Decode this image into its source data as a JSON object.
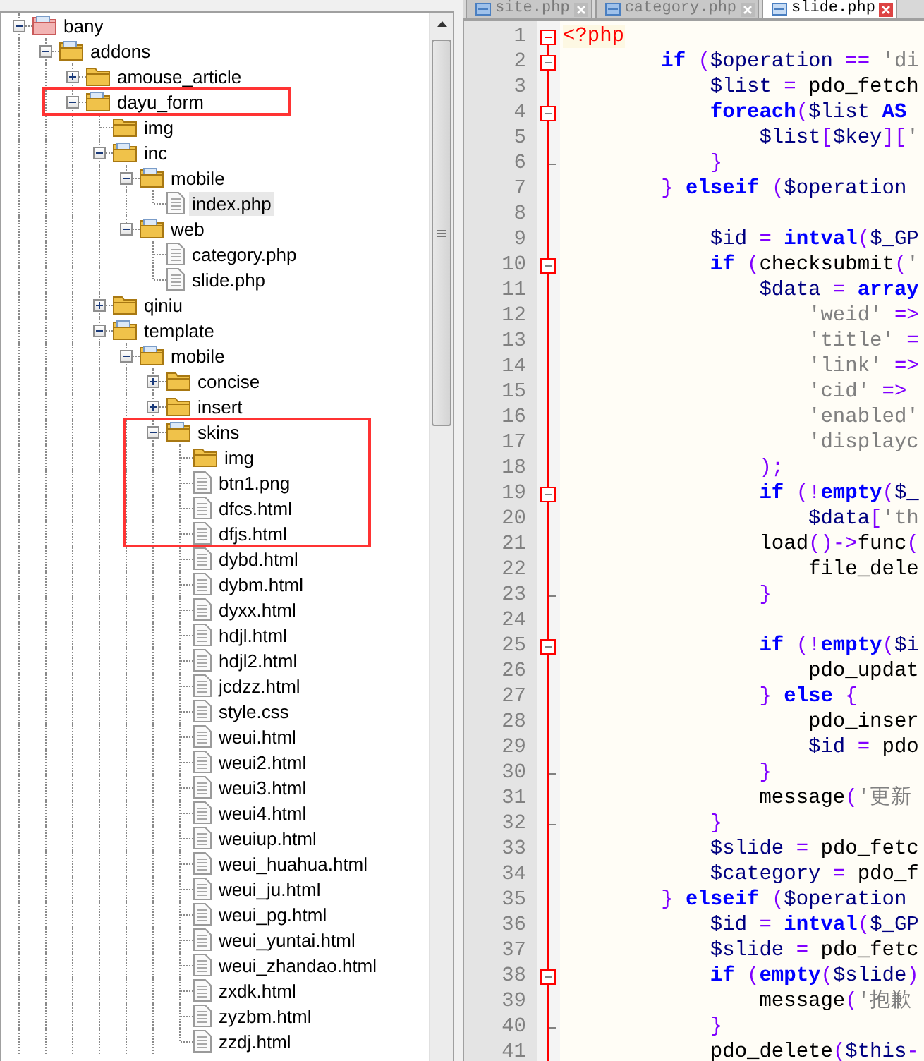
{
  "tree": [
    {
      "label": "bany",
      "kind": "project",
      "expanded": true,
      "selected": false,
      "marked": false,
      "children": [
        {
          "label": "addons",
          "kind": "folder",
          "expanded": true,
          "selected": false,
          "marked": false,
          "children": [
            {
              "label": "amouse_article",
              "kind": "folder",
              "expanded": false,
              "selected": false,
              "marked": false
            },
            {
              "label": "dayu_form",
              "kind": "folder",
              "expanded": true,
              "selected": false,
              "marked": true,
              "children": [
                {
                  "label": "img",
                  "kind": "empty-folder",
                  "selected": false,
                  "marked": false
                },
                {
                  "label": "inc",
                  "kind": "folder",
                  "expanded": true,
                  "selected": false,
                  "marked": false,
                  "children": [
                    {
                      "label": "mobile",
                      "kind": "folder",
                      "expanded": true,
                      "selected": false,
                      "marked": false,
                      "children": [
                        {
                          "label": "index.php",
                          "kind": "file",
                          "selected": true,
                          "marked": false
                        }
                      ]
                    },
                    {
                      "label": "web",
                      "kind": "folder",
                      "expanded": true,
                      "selected": false,
                      "marked": false,
                      "children": [
                        {
                          "label": "category.php",
                          "kind": "file",
                          "selected": false,
                          "marked": false
                        },
                        {
                          "label": "slide.php",
                          "kind": "file",
                          "selected": false,
                          "marked": false
                        }
                      ]
                    }
                  ]
                },
                {
                  "label": "qiniu",
                  "kind": "folder",
                  "expanded": false,
                  "selected": false,
                  "marked": false
                },
                {
                  "label": "template",
                  "kind": "folder",
                  "expanded": true,
                  "selected": false,
                  "marked": false,
                  "children": [
                    {
                      "label": "mobile",
                      "kind": "folder",
                      "expanded": true,
                      "selected": false,
                      "marked": false,
                      "children": [
                        {
                          "label": "concise",
                          "kind": "folder",
                          "expanded": false,
                          "selected": false,
                          "marked": false
                        },
                        {
                          "label": "insert",
                          "kind": "folder",
                          "expanded": false,
                          "selected": false,
                          "marked": false
                        },
                        {
                          "label": "skins",
                          "kind": "folder",
                          "expanded": true,
                          "selected": false,
                          "marked": true,
                          "children": [
                            {
                              "label": "img",
                              "kind": "empty-folder",
                              "selected": false,
                              "marked": true
                            },
                            {
                              "label": "btn1.png",
                              "kind": "file",
                              "selected": false,
                              "marked": true
                            },
                            {
                              "label": "dfcs.html",
                              "kind": "file",
                              "selected": false,
                              "marked": true
                            },
                            {
                              "label": "dfjs.html",
                              "kind": "file",
                              "selected": false,
                              "marked": true
                            },
                            {
                              "label": "dybd.html",
                              "kind": "file",
                              "selected": false,
                              "marked": false
                            },
                            {
                              "label": "dybm.html",
                              "kind": "file",
                              "selected": false,
                              "marked": false
                            },
                            {
                              "label": "dyxx.html",
                              "kind": "file",
                              "selected": false,
                              "marked": false
                            },
                            {
                              "label": "hdjl.html",
                              "kind": "file",
                              "selected": false,
                              "marked": false
                            },
                            {
                              "label": "hdjl2.html",
                              "kind": "file",
                              "selected": false,
                              "marked": false
                            },
                            {
                              "label": "jcdzz.html",
                              "kind": "file",
                              "selected": false,
                              "marked": false
                            },
                            {
                              "label": "style.css",
                              "kind": "file",
                              "selected": false,
                              "marked": false
                            },
                            {
                              "label": "weui.html",
                              "kind": "file",
                              "selected": false,
                              "marked": false
                            },
                            {
                              "label": "weui2.html",
                              "kind": "file",
                              "selected": false,
                              "marked": false
                            },
                            {
                              "label": "weui3.html",
                              "kind": "file",
                              "selected": false,
                              "marked": false
                            },
                            {
                              "label": "weui4.html",
                              "kind": "file",
                              "selected": false,
                              "marked": false
                            },
                            {
                              "label": "weuiup.html",
                              "kind": "file",
                              "selected": false,
                              "marked": false
                            },
                            {
                              "label": "weui_huahua.html",
                              "kind": "file",
                              "selected": false,
                              "marked": false
                            },
                            {
                              "label": "weui_ju.html",
                              "kind": "file",
                              "selected": false,
                              "marked": false
                            },
                            {
                              "label": "weui_pg.html",
                              "kind": "file",
                              "selected": false,
                              "marked": false
                            },
                            {
                              "label": "weui_yuntai.html",
                              "kind": "file",
                              "selected": false,
                              "marked": false
                            },
                            {
                              "label": "weui_zhandao.html",
                              "kind": "file",
                              "selected": false,
                              "marked": false
                            },
                            {
                              "label": "zxdk.html",
                              "kind": "file",
                              "selected": false,
                              "marked": false
                            },
                            {
                              "label": "zyzbm.html",
                              "kind": "file",
                              "selected": false,
                              "marked": false
                            },
                            {
                              "label": "zzdj.html",
                              "kind": "file",
                              "selected": false,
                              "marked": false
                            }
                          ]
                        }
                      ]
                    }
                  ]
                }
              ]
            }
          ]
        }
      ]
    }
  ],
  "editor": {
    "tabs": [
      {
        "label": "site.php",
        "selected": false
      },
      {
        "label": "category.php",
        "selected": false
      },
      {
        "label": "slide.php",
        "selected": true
      }
    ],
    "lines": [
      {
        "number": "1",
        "kind": "fold-current",
        "tokens": [
          {
            "kind": "tag",
            "text": "<?php"
          }
        ]
      },
      {
        "number": "2",
        "kind": "fold-start",
        "tokens": [
          {
            "kind": "kw",
            "text": "        if "
          },
          {
            "kind": "op",
            "text": "("
          },
          {
            "kind": "var",
            "text": "$operation"
          },
          {
            "kind": "op",
            "text": " == "
          },
          {
            "kind": "str",
            "text": "'di"
          }
        ]
      },
      {
        "number": "3",
        "kind": "plain",
        "tokens": [
          {
            "kind": "var",
            "text": "            $list"
          },
          {
            "kind": "op",
            "text": " = "
          },
          {
            "kind": "fn",
            "text": "pdo_fetch"
          }
        ]
      },
      {
        "number": "4",
        "kind": "fold-start",
        "tokens": [
          {
            "kind": "kw",
            "text": "            foreach"
          },
          {
            "kind": "op",
            "text": "("
          },
          {
            "kind": "var",
            "text": "$list"
          },
          {
            "kind": "kw",
            "text": " AS"
          }
        ]
      },
      {
        "number": "5",
        "kind": "plain",
        "tokens": [
          {
            "kind": "var",
            "text": "                $list"
          },
          {
            "kind": "op",
            "text": "["
          },
          {
            "kind": "var",
            "text": "$key"
          },
          {
            "kind": "op",
            "text": "]["
          },
          {
            "kind": "str",
            "text": "'"
          }
        ]
      },
      {
        "number": "6",
        "kind": "fold-end",
        "tokens": [
          {
            "kind": "op",
            "text": "            }"
          }
        ]
      },
      {
        "number": "7",
        "kind": "plain",
        "tokens": [
          {
            "kind": "op",
            "text": "        } "
          },
          {
            "kind": "kw",
            "text": "elseif "
          },
          {
            "kind": "op",
            "text": "("
          },
          {
            "kind": "var",
            "text": "$operation"
          }
        ]
      },
      {
        "number": "8",
        "kind": "plain"
      },
      {
        "number": "9",
        "kind": "plain",
        "tokens": [
          {
            "kind": "var",
            "text": "            $id"
          },
          {
            "kind": "op",
            "text": " = "
          },
          {
            "kind": "kw",
            "text": "intval"
          },
          {
            "kind": "op",
            "text": "("
          },
          {
            "kind": "var",
            "text": "$_GP"
          }
        ]
      },
      {
        "number": "10",
        "kind": "fold-start",
        "tokens": [
          {
            "kind": "kw",
            "text": "            if "
          },
          {
            "kind": "op",
            "text": "("
          },
          {
            "kind": "fn",
            "text": "checksubmit"
          },
          {
            "kind": "op",
            "text": "("
          },
          {
            "kind": "str",
            "text": "'"
          }
        ]
      },
      {
        "number": "11",
        "kind": "plain",
        "tokens": [
          {
            "kind": "var",
            "text": "                $data"
          },
          {
            "kind": "op",
            "text": " = "
          },
          {
            "kind": "kw",
            "text": "array"
          }
        ]
      },
      {
        "number": "12",
        "kind": "plain",
        "tokens": [
          {
            "kind": "str",
            "text": "                    'weid'"
          },
          {
            "kind": "op",
            "text": " =>"
          }
        ]
      },
      {
        "number": "13",
        "kind": "plain",
        "tokens": [
          {
            "kind": "str",
            "text": "                    'title'"
          },
          {
            "kind": "op",
            "text": " ="
          }
        ]
      },
      {
        "number": "14",
        "kind": "plain",
        "tokens": [
          {
            "kind": "str",
            "text": "                    'link'"
          },
          {
            "kind": "op",
            "text": " =>"
          }
        ]
      },
      {
        "number": "15",
        "kind": "plain",
        "tokens": [
          {
            "kind": "str",
            "text": "                    'cid'"
          },
          {
            "kind": "op",
            "text": " =>"
          }
        ]
      },
      {
        "number": "16",
        "kind": "plain",
        "tokens": [
          {
            "kind": "str",
            "text": "                    'enabled'"
          }
        ]
      },
      {
        "number": "17",
        "kind": "plain",
        "tokens": [
          {
            "kind": "str",
            "text": "                    'displayc"
          }
        ]
      },
      {
        "number": "18",
        "kind": "plain",
        "tokens": [
          {
            "kind": "op",
            "text": "                );"
          }
        ]
      },
      {
        "number": "19",
        "kind": "fold-start",
        "tokens": [
          {
            "kind": "kw",
            "text": "                if "
          },
          {
            "kind": "op",
            "text": "(!"
          },
          {
            "kind": "kw",
            "text": "empty"
          },
          {
            "kind": "op",
            "text": "("
          },
          {
            "kind": "var",
            "text": "$_"
          }
        ]
      },
      {
        "number": "20",
        "kind": "plain",
        "tokens": [
          {
            "kind": "var",
            "text": "                    $data"
          },
          {
            "kind": "op",
            "text": "["
          },
          {
            "kind": "str",
            "text": "'th"
          }
        ]
      },
      {
        "number": "21",
        "kind": "plain",
        "tokens": [
          {
            "kind": "fn",
            "text": "                load"
          },
          {
            "kind": "op",
            "text": "()->"
          },
          {
            "kind": "fn",
            "text": "func"
          },
          {
            "kind": "op",
            "text": "("
          }
        ]
      },
      {
        "number": "22",
        "kind": "plain",
        "tokens": [
          {
            "kind": "fn",
            "text": "                    file_dele"
          }
        ]
      },
      {
        "number": "23",
        "kind": "fold-end",
        "tokens": [
          {
            "kind": "op",
            "text": "                }"
          }
        ]
      },
      {
        "number": "24",
        "kind": "plain"
      },
      {
        "number": "25",
        "kind": "fold-start",
        "tokens": [
          {
            "kind": "kw",
            "text": "                if "
          },
          {
            "kind": "op",
            "text": "(!"
          },
          {
            "kind": "kw",
            "text": "empty"
          },
          {
            "kind": "op",
            "text": "("
          },
          {
            "kind": "var",
            "text": "$i"
          }
        ]
      },
      {
        "number": "26",
        "kind": "plain",
        "tokens": [
          {
            "kind": "fn",
            "text": "                    pdo_updat"
          }
        ]
      },
      {
        "number": "27",
        "kind": "plain",
        "tokens": [
          {
            "kind": "op",
            "text": "                } "
          },
          {
            "kind": "kw",
            "text": "else "
          },
          {
            "kind": "op",
            "text": "{"
          }
        ]
      },
      {
        "number": "28",
        "kind": "plain",
        "tokens": [
          {
            "kind": "fn",
            "text": "                    pdo_inser"
          }
        ]
      },
      {
        "number": "29",
        "kind": "plain",
        "tokens": [
          {
            "kind": "var",
            "text": "                    $id"
          },
          {
            "kind": "op",
            "text": " = "
          },
          {
            "kind": "fn",
            "text": "pdo"
          }
        ]
      },
      {
        "number": "30",
        "kind": "fold-end",
        "tokens": [
          {
            "kind": "op",
            "text": "                }"
          }
        ]
      },
      {
        "number": "31",
        "kind": "plain",
        "tokens": [
          {
            "kind": "fn",
            "text": "                message"
          },
          {
            "kind": "op",
            "text": "("
          },
          {
            "kind": "str",
            "text": "'更新"
          }
        ]
      },
      {
        "number": "32",
        "kind": "fold-end",
        "tokens": [
          {
            "kind": "op",
            "text": "            }"
          }
        ]
      },
      {
        "number": "33",
        "kind": "plain",
        "tokens": [
          {
            "kind": "var",
            "text": "            $slide"
          },
          {
            "kind": "op",
            "text": " = "
          },
          {
            "kind": "fn",
            "text": "pdo_fetc"
          }
        ]
      },
      {
        "number": "34",
        "kind": "plain",
        "tokens": [
          {
            "kind": "var",
            "text": "            $category"
          },
          {
            "kind": "op",
            "text": " = "
          },
          {
            "kind": "fn",
            "text": "pdo_f"
          }
        ]
      },
      {
        "number": "35",
        "kind": "plain",
        "tokens": [
          {
            "kind": "op",
            "text": "        } "
          },
          {
            "kind": "kw",
            "text": "elseif "
          },
          {
            "kind": "op",
            "text": "("
          },
          {
            "kind": "var",
            "text": "$operation"
          }
        ]
      },
      {
        "number": "36",
        "kind": "plain",
        "tokens": [
          {
            "kind": "var",
            "text": "            $id"
          },
          {
            "kind": "op",
            "text": " = "
          },
          {
            "kind": "kw",
            "text": "intval"
          },
          {
            "kind": "op",
            "text": "("
          },
          {
            "kind": "var",
            "text": "$_GP"
          }
        ]
      },
      {
        "number": "37",
        "kind": "plain",
        "tokens": [
          {
            "kind": "var",
            "text": "            $slide"
          },
          {
            "kind": "op",
            "text": " = "
          },
          {
            "kind": "fn",
            "text": "pdo_fetc"
          }
        ]
      },
      {
        "number": "38",
        "kind": "fold-start",
        "tokens": [
          {
            "kind": "kw",
            "text": "            if "
          },
          {
            "kind": "op",
            "text": "("
          },
          {
            "kind": "kw",
            "text": "empty"
          },
          {
            "kind": "op",
            "text": "("
          },
          {
            "kind": "var",
            "text": "$slide"
          },
          {
            "kind": "op",
            "text": ")"
          }
        ]
      },
      {
        "number": "39",
        "kind": "plain",
        "tokens": [
          {
            "kind": "fn",
            "text": "                message"
          },
          {
            "kind": "op",
            "text": "("
          },
          {
            "kind": "str",
            "text": "'抱歉"
          }
        ]
      },
      {
        "number": "40",
        "kind": "fold-end",
        "tokens": [
          {
            "kind": "op",
            "text": "            }"
          }
        ]
      },
      {
        "number": "41",
        "kind": "plain",
        "tokens": [
          {
            "kind": "fn",
            "text": "            pdo_delete"
          },
          {
            "kind": "op",
            "text": "("
          },
          {
            "kind": "var",
            "text": "$this"
          },
          {
            "kind": "op",
            "text": "-"
          }
        ]
      }
    ]
  }
}
